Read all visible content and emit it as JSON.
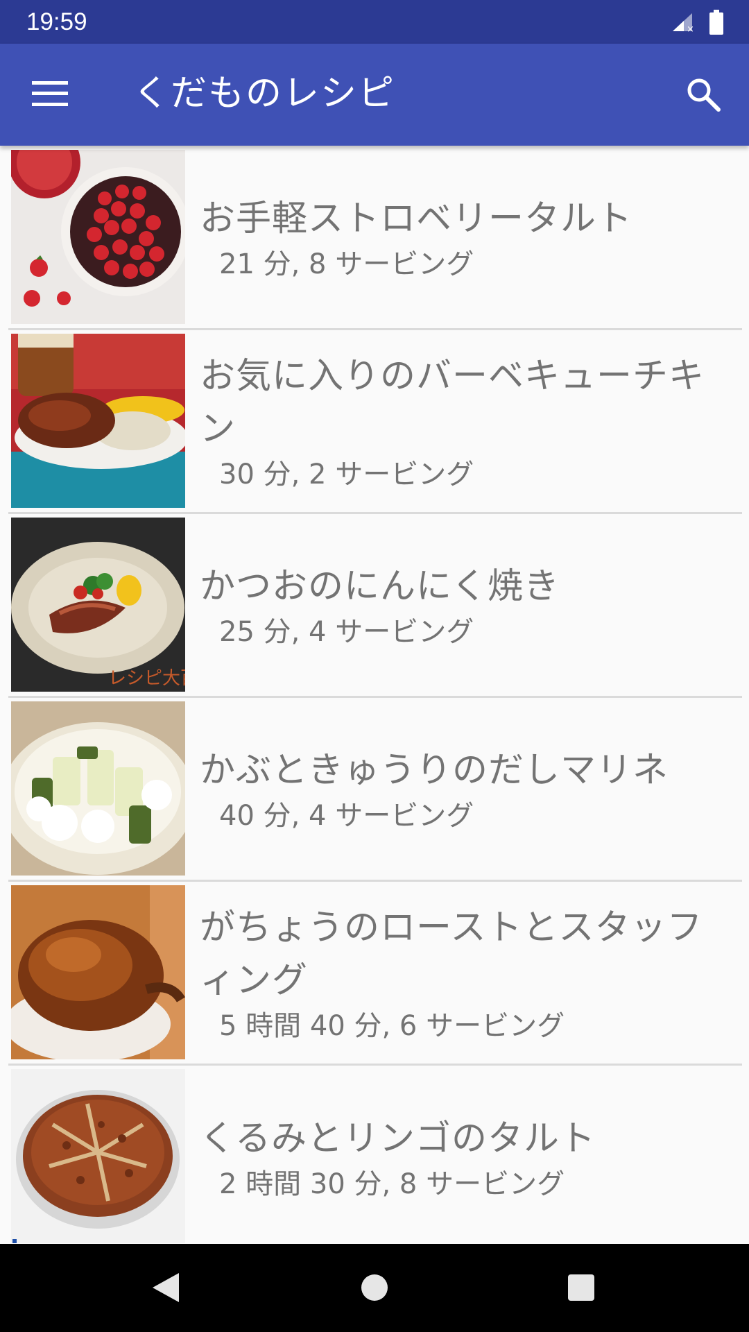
{
  "status_bar": {
    "time": "19:59",
    "icons": [
      "signal-no-data-icon",
      "battery-icon"
    ]
  },
  "app_bar": {
    "title": "くだものレシピ",
    "menu_icon": "hamburger-menu-icon",
    "search_icon": "search-icon",
    "background": "#3f51b5",
    "status_background": "#2c3a93"
  },
  "recipes": [
    {
      "title": "お手軽ストロベリータルト",
      "meta": "21 分, 8 サービング",
      "image": "strawberry-tart-photo"
    },
    {
      "title": "お気に入りのバーベキューチキン",
      "meta": "30 分, 2 サービング",
      "image": "bbq-chicken-photo"
    },
    {
      "title": "かつおのにんにく焼き",
      "meta": "25 分, 4 サービング",
      "image": "grilled-bonito-photo",
      "image_caption": "レシピ大百"
    },
    {
      "title": "かぶときゅうりのだしマリネ",
      "meta": "40 分, 4 サービング",
      "image": "turnip-cucumber-marinade-photo"
    },
    {
      "title": "がちょうのローストとスタッフィング",
      "meta": "5 時間 40 分, 6 サービング",
      "image": "roast-goose-photo"
    },
    {
      "title": "くるみとリンゴのタルト",
      "meta": "2 時間 30 分, 8 サービング",
      "image": "walnut-apple-tart-photo"
    }
  ],
  "nav_bar": {
    "back_icon": "back-triangle-icon",
    "home_icon": "home-circle-icon",
    "recents_icon": "recents-square-icon"
  }
}
